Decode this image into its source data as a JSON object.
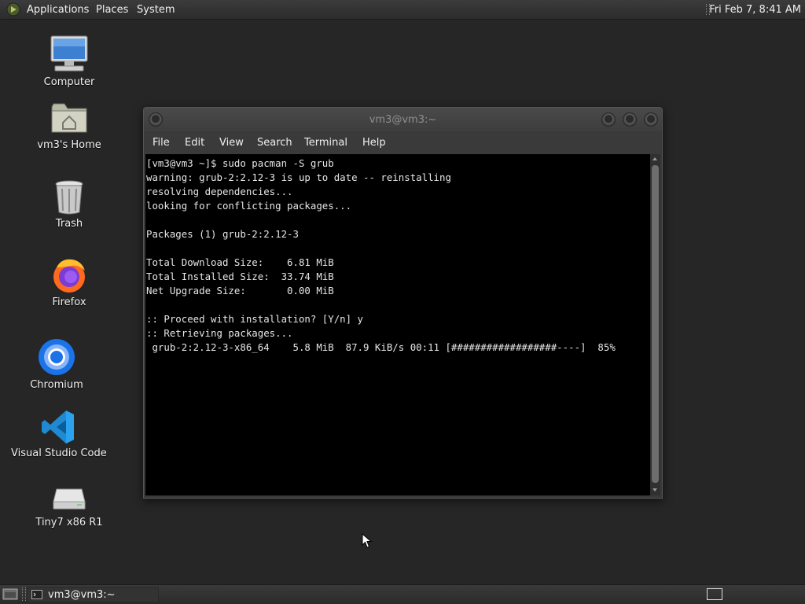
{
  "top_panel": {
    "menus": [
      "Applications",
      "Places",
      "System"
    ],
    "clock": "Fri Feb  7,  8:41 AM"
  },
  "desktop_icons": [
    {
      "label": "Computer",
      "icon": "computer-icon"
    },
    {
      "label": "vm3's Home",
      "icon": "home-folder-icon"
    },
    {
      "label": "Trash",
      "icon": "trash-icon"
    },
    {
      "label": "Firefox",
      "icon": "firefox-icon"
    },
    {
      "label": "Chromium",
      "icon": "chromium-icon"
    },
    {
      "label": "Visual Studio Code",
      "icon": "vscode-icon"
    },
    {
      "label": "Tiny7 x86 R1",
      "icon": "drive-icon"
    }
  ],
  "window": {
    "title": "vm3@vm3:~",
    "menu": [
      "File",
      "Edit",
      "View",
      "Search",
      "Terminal",
      "Help"
    ],
    "terminal_lines": [
      "[vm3@vm3 ~]$ sudo pacman -S grub",
      "warning: grub-2:2.12-3 is up to date -- reinstalling",
      "resolving dependencies...",
      "looking for conflicting packages...",
      "",
      "Packages (1) grub-2:2.12-3",
      "",
      "Total Download Size:    6.81 MiB",
      "Total Installed Size:  33.74 MiB",
      "Net Upgrade Size:       0.00 MiB",
      "",
      ":: Proceed with installation? [Y/n] y",
      ":: Retrieving packages...",
      " grub-2:2.12-3-x86_64    5.8 MiB  87.9 KiB/s 00:11 [##################----]  85%"
    ]
  },
  "taskbar": {
    "items": [
      {
        "label": "vm3@vm3:~",
        "icon": "terminal-icon"
      }
    ]
  },
  "colors": {
    "desktop": "#262626",
    "panel": "#333333",
    "terminal_bg": "#000000",
    "terminal_fg": "#e6e6e6"
  }
}
